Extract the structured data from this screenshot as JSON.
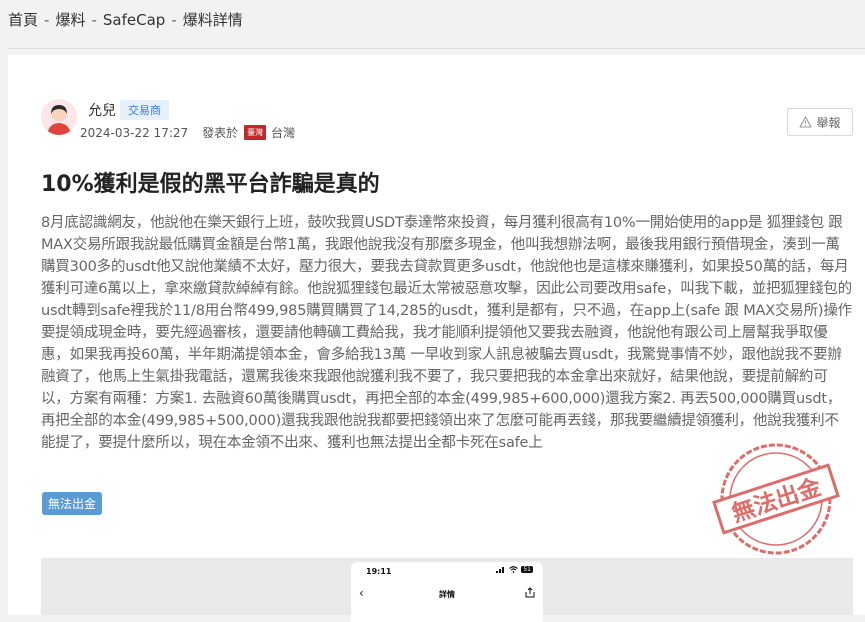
{
  "breadcrumb": {
    "home": "首頁",
    "exposure": "爆料",
    "platform": "SafeCap",
    "current": "爆料詳情",
    "separator": "-"
  },
  "post": {
    "author": "允兒",
    "role": "交易商",
    "date": "2024-03-22 17:27",
    "posted_in": "發表於",
    "flag_label": "臺灣",
    "country": "台灣",
    "report_label": "舉報",
    "title": "10%獲利是假的黑平台詐騙是真的",
    "body": "8月底認識網友，他說他在樂天銀行上班，鼓吹我買USDT泰達幣來投資，每月獲利很高有10%一開始使用的app是 狐狸錢包 跟 MAX交易所跟我說最低購買金額是台幣1萬，我跟他說我沒有那麼多現金，他叫我想辦法啊，最後我用銀行預借現金，湊到一萬購買300多的usdt他又說他業績不太好，壓力很大，要我去貸款買更多usdt，他說他也是這樣來賺獲利，如果投50萬的話，每月獲利可達6萬以上，拿來繳貸款綽綽有餘。他說狐狸錢包最近太常被惡意攻擊，因此公司要改用safe，叫我下載，並把狐狸錢包的usdt轉到safe裡我於11/8用台幣499,985購買購買了14,285的usdt，獲利是都有，只不過，在app上(safe 跟 MAX交易所)操作要提領成現金時，要先經過審核，還要請他轉礦工費給我，我才能順利提領他又要我去融資，他說他有跟公司上層幫我爭取優惠，如果我再投60萬，半年期滿提領本金，會多給我13萬 一早收到家人訊息被騙去買usdt，我驚覺事情不妙，跟他說我不要辦融資了，他馬上生氣掛我電話，還罵我後來我跟他說獲利我不要了，我只要把我的本金拿出來就好，結果他說，要提前解約可以，方案有兩種：方案1. 去融資60萬後購買usdt，再把全部的本金(499,985+600,000)還我方案2. 再丟500,000購買usdt，再把全部的本金(499,985+500,000)還我我跟他說我都要把錢領出來了怎麼可能再丟錢，那我要繼續提領獲利，他說我獲利不能提了，要提什麼所以，現在本金領不出來、獲利也無法提出全都卡死在safe上",
    "tag": "無法出金",
    "stamp_text": "無法出金"
  },
  "screenshot_preview": {
    "time": "19:11",
    "title": "詳情",
    "battery": "51"
  },
  "colors": {
    "accent_blue": "#5b9bd5",
    "badge_bg": "#e6f0fb",
    "stamp_red": "#d9534f",
    "flag_red": "#c22a2a"
  }
}
